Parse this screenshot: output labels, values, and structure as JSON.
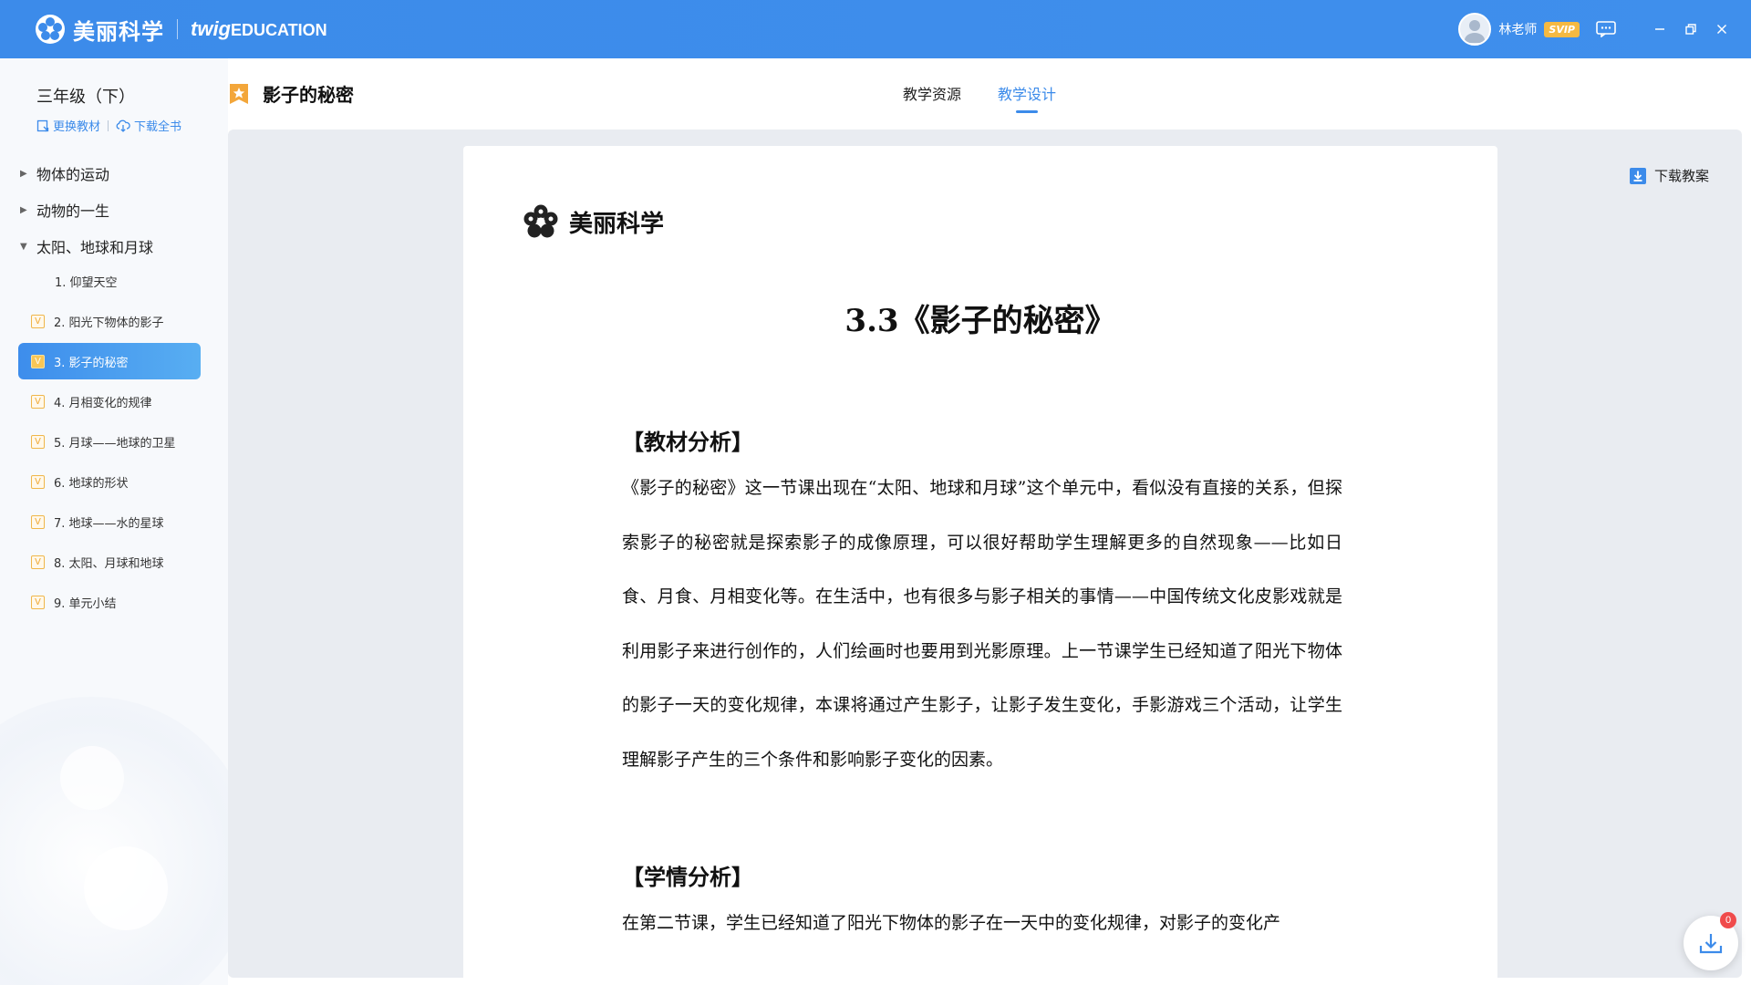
{
  "app": {
    "brand_name": "美丽科学",
    "brand_sub_twig": "twig",
    "brand_sub_edu": "EDUCATION",
    "user_name": "林老师",
    "user_badge": "SVIP",
    "window_controls": [
      "minimize-icon",
      "restore-icon",
      "close-icon"
    ]
  },
  "sidebar": {
    "grade": "三年级（下）",
    "change_book": "更换教材",
    "download_book": "下载全书",
    "units": [
      {
        "label": "物体的运动",
        "expanded": false
      },
      {
        "label": "动物的一生",
        "expanded": false
      },
      {
        "label": "太阳、地球和月球",
        "expanded": true
      }
    ],
    "lessons": [
      {
        "label": "1. 仰望天空",
        "badge": ""
      },
      {
        "label": "2. 阳光下物体的影子",
        "badge": "V"
      },
      {
        "label": "3. 影子的秘密",
        "badge": "V",
        "active": true
      },
      {
        "label": "4. 月相变化的规律",
        "badge": "V"
      },
      {
        "label": "5. 月球——地球的卫星",
        "badge": "V"
      },
      {
        "label": "6. 地球的形状",
        "badge": "V"
      },
      {
        "label": "7. 地球——水的星球",
        "badge": "V"
      },
      {
        "label": "8. 太阳、月球和地球",
        "badge": "V"
      },
      {
        "label": "9. 单元小结",
        "badge": "V"
      }
    ]
  },
  "header": {
    "title": "影子的秘密",
    "tabs": [
      {
        "label": "教学资源",
        "active": false
      },
      {
        "label": "教学设计",
        "active": true
      }
    ],
    "download_plan": "下载教案"
  },
  "document": {
    "logo_name": "美丽科学",
    "title": "3.3《影子的秘密》",
    "sections": [
      {
        "heading": "【教材分析】",
        "text": "《影子的秘密》这一节课出现在“太阳、地球和月球”这个单元中，看似没有直接的关系，但探索影子的秘密就是探索影子的成像原理，可以很好帮助学生理解更多的自然现象——比如日食、月食、月相变化等。在生活中，也有很多与影子相关的事情——中国传统文化皮影戏就是利用影子来进行创作的，人们绘画时也要用到光影原理。上一节课学生已经知道了阳光下物体的影子一天的变化规律，本课将通过产生影子，让影子发生变化，手影游戏三个活动，让学生理解影子产生的三个条件和影响影子变化的因素。"
      },
      {
        "heading": "【学情分析】",
        "text": "在第二节课，学生已经知道了阳光下物体的影子在一天中的变化规律，对影子的变化产"
      }
    ]
  },
  "floating": {
    "download_count": "0"
  }
}
